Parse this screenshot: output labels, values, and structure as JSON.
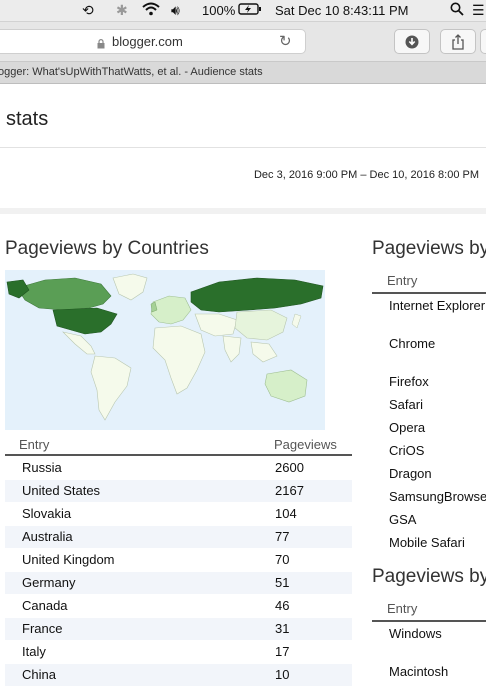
{
  "menubar": {
    "battery": "100%",
    "datetime": "Sat Dec 10  8:43:11 PM"
  },
  "browser": {
    "url": "blogger.com",
    "tab_title": "ogger: What'sUpWithThatWatts, et al. - Audience stats"
  },
  "page": {
    "title": "stats",
    "date_range": "Dec 3, 2016 9:00 PM – Dec 10, 2016 8:00 PM"
  },
  "countries": {
    "title": "Pageviews by Countries",
    "col_entry": "Entry",
    "col_pageviews": "Pageviews",
    "rows": [
      {
        "entry": "Russia",
        "pageviews": "2600"
      },
      {
        "entry": "United States",
        "pageviews": "2167"
      },
      {
        "entry": "Slovakia",
        "pageviews": "104"
      },
      {
        "entry": "Australia",
        "pageviews": "77"
      },
      {
        "entry": "United Kingdom",
        "pageviews": "70"
      },
      {
        "entry": "Germany",
        "pageviews": "51"
      },
      {
        "entry": "Canada",
        "pageviews": "46"
      },
      {
        "entry": "France",
        "pageviews": "31"
      },
      {
        "entry": "Italy",
        "pageviews": "17"
      },
      {
        "entry": "China",
        "pageviews": "10"
      }
    ],
    "map_colors": {
      "ocean": "#e4f1fb",
      "land": "#f5faeb",
      "low": "#d6efc9",
      "mid": "#5a9e55",
      "high": "#2a6f2b"
    }
  },
  "browsers": {
    "title": "Pageviews by",
    "col_entry": "Entry",
    "rows": [
      "Internet Explorer",
      "Chrome",
      "Firefox",
      "Safari",
      "Opera",
      "CriOS",
      "Dragon",
      "SamsungBrowse",
      "GSA",
      "Mobile Safari"
    ]
  },
  "os": {
    "title": "Pageviews by",
    "col_entry": "Entry",
    "rows": [
      "Windows",
      "Macintosh"
    ]
  }
}
